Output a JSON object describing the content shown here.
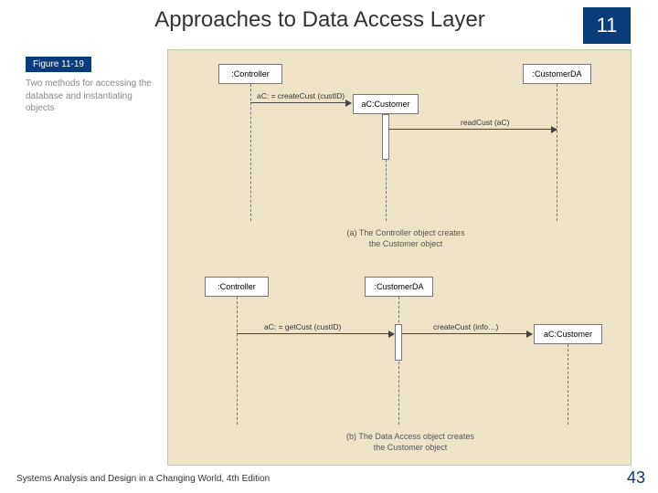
{
  "header": {
    "title": "Approaches to Data Access Layer",
    "chapter_number": "11"
  },
  "figure_label": {
    "tag": "Figure 11-19",
    "caption": "Two methods for accessing the database and instantiating objects"
  },
  "diagram": {
    "top": {
      "lifelines": {
        "controller": ":Controller",
        "customer": "aC:Customer",
        "customer_da": ":CustomerDA"
      },
      "messages": {
        "create_cust": "aC: = createCust (custID)",
        "read_cust": "readCust (aC)"
      },
      "caption": "(a) The Controller object creates\nthe Customer object"
    },
    "bottom": {
      "lifelines": {
        "controller": ":Controller",
        "customer_da": ":CustomerDA",
        "customer": "aC:Customer"
      },
      "messages": {
        "get_cust": "aC: = getCust (custID)",
        "create_cust": "createCust (info…)"
      },
      "caption": "(b) The Data Access object creates\nthe Customer object"
    }
  },
  "footer": {
    "book": "Systems Analysis and Design in a Changing World, 4th Edition",
    "slide_number": "43"
  }
}
